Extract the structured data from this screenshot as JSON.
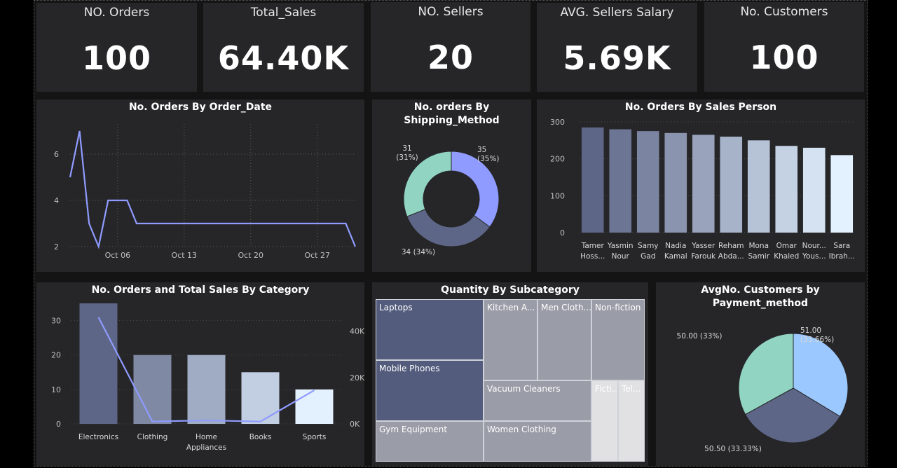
{
  "kpis": [
    {
      "title": "NO. Orders",
      "value": "100"
    },
    {
      "title": "Total_Sales",
      "value": "64.40K"
    },
    {
      "title": "NO. Sellers",
      "value": "20"
    },
    {
      "title": "AVG. Sellers Salary",
      "value": "5.69K"
    },
    {
      "title": "No. Customers",
      "value": "100"
    }
  ],
  "colors": {
    "background": "#141414",
    "card": "#262628",
    "line": "#8f9bff",
    "bar_dark": "#5d6686",
    "bar_light": "#e3f1ff",
    "pie_green": "#90d4c1",
    "pie_blue": "#9bc9ff",
    "pie_slate": "#5d6686",
    "donut_blue": "#8f9bff"
  },
  "chart_data": [
    {
      "id": "orders_by_date",
      "type": "line",
      "title": "No. Orders By Order_Date",
      "x_tick_labels": [
        "Oct 06",
        "Oct 13",
        "Oct 20",
        "Oct 27"
      ],
      "x_tick_days": [
        6,
        13,
        20,
        27
      ],
      "y_ticks": [
        2,
        4,
        6
      ],
      "ylim": [
        2,
        7
      ],
      "x": [
        1,
        2,
        3,
        4,
        5,
        6,
        7,
        8,
        9,
        10,
        11,
        12,
        13,
        14,
        15,
        16,
        17,
        18,
        19,
        20,
        21,
        22,
        23,
        24,
        25,
        26,
        27,
        28,
        29,
        30,
        31
      ],
      "y": [
        5,
        7,
        3,
        2,
        4,
        4,
        4,
        3,
        3,
        3,
        3,
        3,
        3,
        3,
        3,
        3,
        3,
        3,
        3,
        3,
        3,
        3,
        3,
        3,
        3,
        3,
        3,
        3,
        3,
        3,
        2
      ]
    },
    {
      "id": "orders_by_shipping",
      "type": "pie",
      "donut": true,
      "title_line1": "No. orders By",
      "title_line2": "Shipping_Method",
      "slices": [
        {
          "value": 35,
          "label_value": "35",
          "label_pct": "(35%)",
          "color": "#8f9bff"
        },
        {
          "value": 34,
          "label_value": "34 (34%)",
          "label_pct": "",
          "color": "#5d6686"
        },
        {
          "value": 31,
          "label_value": "31",
          "label_pct": "(31%)",
          "color": "#90d4c1"
        }
      ]
    },
    {
      "id": "orders_by_salesperson",
      "type": "bar",
      "title": "No. Orders By Sales Person",
      "y_ticks": [
        0,
        100,
        200,
        300
      ],
      "ylim": [
        0,
        300
      ],
      "categories": [
        {
          "line1": "Tamer",
          "line2": "Hoss..."
        },
        {
          "line1": "Yasmin",
          "line2": "Nour"
        },
        {
          "line1": "Samy",
          "line2": "Gad"
        },
        {
          "line1": "Nadia",
          "line2": "Kamal"
        },
        {
          "line1": "Yasser",
          "line2": "Farouk"
        },
        {
          "line1": "Reham",
          "line2": "Abda..."
        },
        {
          "line1": "Mona",
          "line2": "Samir"
        },
        {
          "line1": "Omar",
          "line2": "Khaled"
        },
        {
          "line1": "Nour...",
          "line2": "Yous..."
        },
        {
          "line1": "Sara",
          "line2": "Ibrah..."
        }
      ],
      "values": [
        285,
        280,
        275,
        270,
        265,
        260,
        250,
        235,
        230,
        210
      ]
    },
    {
      "id": "orders_sales_by_category",
      "type": "bar",
      "title": "No. Orders and Total Sales By Category",
      "categories": [
        {
          "line1": "Electronics",
          "line2": ""
        },
        {
          "line1": "Clothing",
          "line2": ""
        },
        {
          "line1": "Home",
          "line2": "Appliances"
        },
        {
          "line1": "Books",
          "line2": ""
        },
        {
          "line1": "Sports",
          "line2": ""
        }
      ],
      "y_ticks": [
        0,
        10,
        20,
        30
      ],
      "ylim": [
        0,
        35
      ],
      "y2_ticks": [
        "0K",
        "20K",
        "40K"
      ],
      "y2lim": [
        0,
        52000
      ],
      "series": [
        {
          "kind": "bar",
          "values": [
            35,
            20,
            20,
            15,
            10
          ]
        },
        {
          "kind": "line",
          "values": [
            46000,
            1000,
            1500,
            1000,
            14500
          ]
        }
      ]
    },
    {
      "id": "qty_by_subcategory",
      "type": "treemap",
      "title": "Quantity By Subcategory",
      "labels": [
        "Laptops",
        "Mobile Phones",
        "Gym Equipment",
        "Kitchen A...",
        "Men Cloth...",
        "Non-fiction",
        "Vacuum Cleaners",
        "Women Clothing",
        "Ficti...",
        "Tel..."
      ]
    },
    {
      "id": "customers_by_payment",
      "type": "pie",
      "donut": false,
      "title_line1": "AvgNo. Customers by",
      "title_line2": "Payment_method",
      "slices": [
        {
          "value": 51,
          "label_value": "51.00",
          "label_pct": "(33.66%)",
          "color": "#9bc9ff"
        },
        {
          "value": 50.5,
          "label_value": "50.50 (33.33%)",
          "label_pct": "",
          "color": "#5d6686"
        },
        {
          "value": 50,
          "label_value": "50.00 (33%)",
          "label_pct": "",
          "color": "#90d4c1"
        }
      ]
    }
  ]
}
